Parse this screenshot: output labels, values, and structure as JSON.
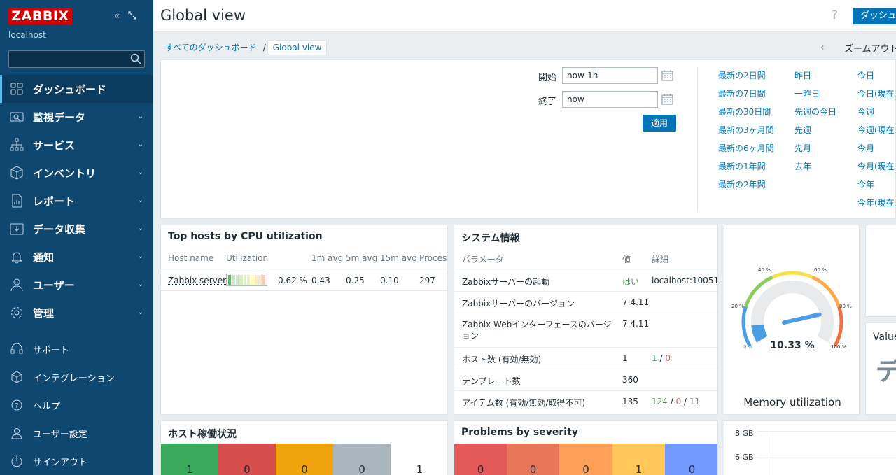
{
  "sidebar": {
    "logo": "ZABBIX",
    "hostname": "localhost",
    "search_placeholder": "",
    "items": [
      {
        "label": "ダッシュボード",
        "icon": "dashboard-icon"
      },
      {
        "label": "監視データ",
        "icon": "monitoring-icon"
      },
      {
        "label": "サービス",
        "icon": "services-icon"
      },
      {
        "label": "インベントリ",
        "icon": "inventory-icon"
      },
      {
        "label": "レポート",
        "icon": "reports-icon"
      },
      {
        "label": "データ収集",
        "icon": "data-collection-icon"
      },
      {
        "label": "通知",
        "icon": "bell-icon"
      },
      {
        "label": "ユーザー",
        "icon": "users-icon"
      },
      {
        "label": "管理",
        "icon": "gear-icon"
      }
    ],
    "bottom_items": [
      {
        "label": "サポート",
        "icon": "headset-icon"
      },
      {
        "label": "インテグレーション",
        "icon": "integrations-icon"
      },
      {
        "label": "ヘルプ",
        "icon": "help-icon"
      },
      {
        "label": "ユーザー設定",
        "icon": "user-settings-icon"
      },
      {
        "label": "サインアウト",
        "icon": "power-icon"
      }
    ]
  },
  "header": {
    "title": "Global view",
    "help": "?",
    "dashboard_button": "ダッシュボード"
  },
  "breadcrumb": {
    "all": "すべてのダッシュボード",
    "sep": "/",
    "current": "Global view"
  },
  "zoom": {
    "prev": "‹",
    "out": "ズームアウト"
  },
  "filter": {
    "from_label": "開始",
    "from_value": "now-1h",
    "to_label": "終了",
    "to_value": "now",
    "apply": "適用",
    "ranges_col1": [
      "最新の2日間",
      "最新の7日間",
      "最新の30日間",
      "最新の3ヶ月間",
      "最新の6ヶ月間",
      "最新の1年間",
      "最新の2年間"
    ],
    "ranges_col2": [
      "昨日",
      "一昨日",
      "先週の今日",
      "先週",
      "先月",
      "去年"
    ],
    "ranges_col3": [
      "今日",
      "今日(現在まで)",
      "今週",
      "今週(現在まで)",
      "今月",
      "今月(現在まで)",
      "今年",
      "今年(現在まで)"
    ]
  },
  "top_hosts": {
    "title": "Top hosts by CPU utilization",
    "columns": [
      "Host name",
      "Utilization",
      "1m avg",
      "5m avg",
      "15m avg",
      "Processes"
    ],
    "row": {
      "host": "Zabbix server",
      "util": "0.62 %",
      "util_fraction": 0.0062,
      "m1": "0.43",
      "m5": "0.25",
      "m15": "0.10",
      "proc": "297"
    }
  },
  "system_info": {
    "title": "システム情報",
    "columns": [
      "パラメータ",
      "値",
      "詳細"
    ],
    "rows": [
      {
        "param": "Zabbixサーバーの起動",
        "value": "はい",
        "detail": "localhost:10051"
      },
      {
        "param": "Zabbixサーバーのバージョン",
        "value": "7.4.11",
        "detail": ""
      },
      {
        "param": "Zabbix Webインターフェースのバージョン",
        "value": "7.4.11",
        "detail": ""
      },
      {
        "param": "ホスト数 (有効/無効)",
        "value": "1",
        "d1": "1",
        "d2": "0"
      },
      {
        "param": "テンプレート数",
        "value": "360",
        "detail": ""
      },
      {
        "param": "アイテム数 (有効/無効/取得不可)",
        "value": "135",
        "d1": "124",
        "d2": "0",
        "d3": "11"
      }
    ]
  },
  "gauge": {
    "value": "10.33 %",
    "value_num": 10.33,
    "label": "Memory utilization",
    "ticks": [
      "0 %",
      "20 %",
      "40 %",
      "60 %",
      "80 %",
      "100 %"
    ]
  },
  "value_widget": {
    "title": "Value",
    "glyph": "デ"
  },
  "host_availability": {
    "title": "ホスト稼働状況",
    "counts": [
      "1",
      "0",
      "0",
      "0",
      "1"
    ],
    "colors": [
      "#3aaa5d",
      "#d64e4e",
      "#f0a30a",
      "#aab5bd",
      "#ffffff"
    ]
  },
  "problems": {
    "title": "Problems by severity",
    "counts": [
      "0",
      "0",
      "0",
      "1",
      "0"
    ],
    "colors": [
      "#e45959",
      "#e97659",
      "#ffa059",
      "#ffc859",
      "#7499ff"
    ]
  },
  "graph": {
    "ticks": [
      "8 GB",
      "6 GB"
    ]
  },
  "colors": {
    "sidebar": "#0e4770",
    "accent": "#0275b8",
    "logo": "#d40000"
  }
}
